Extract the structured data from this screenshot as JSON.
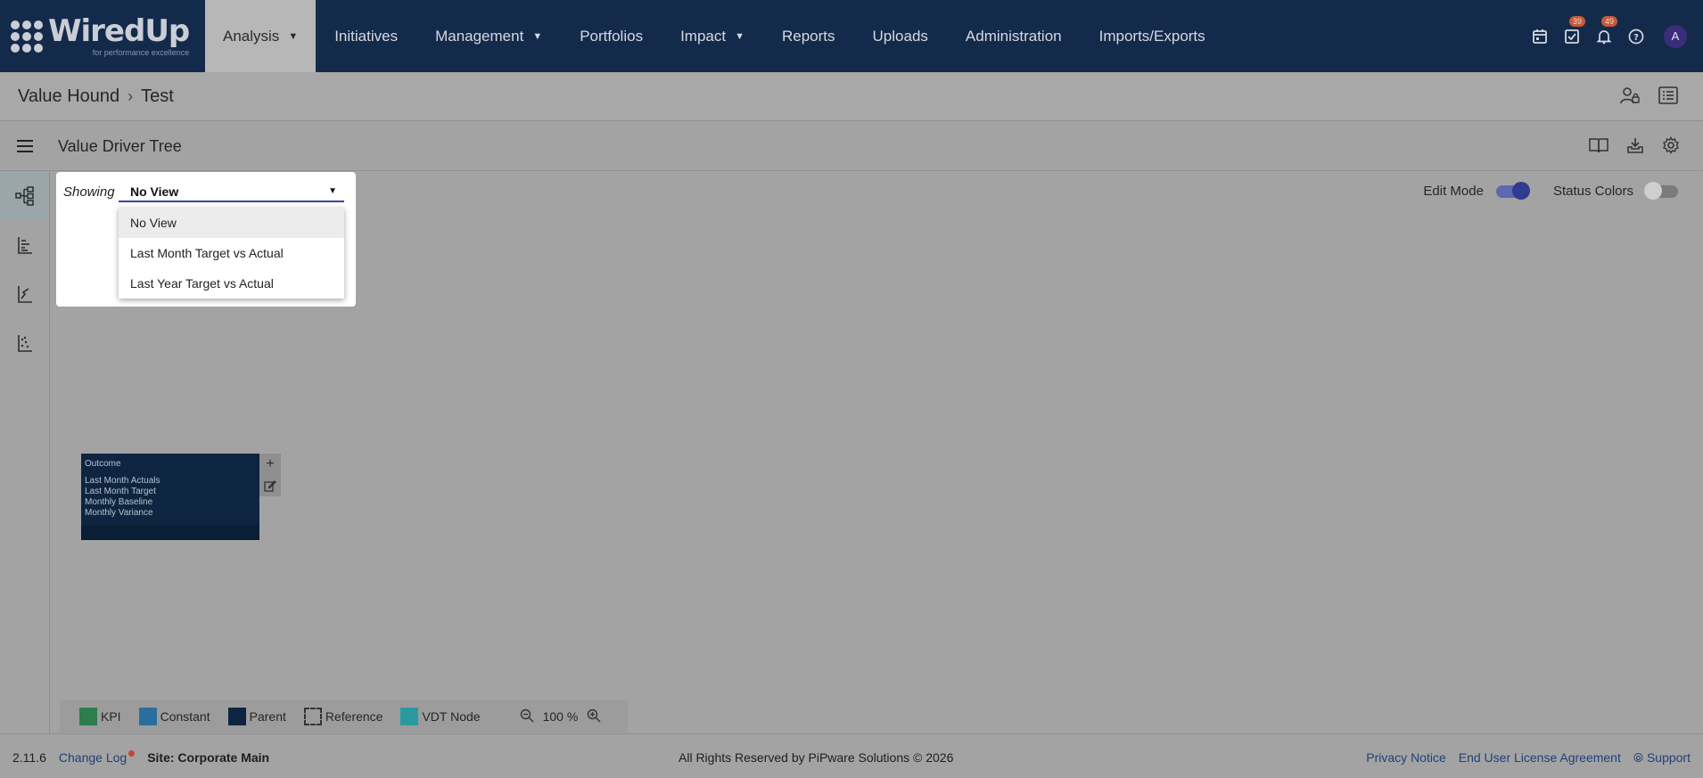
{
  "brand": {
    "name": "WiredUp",
    "tagline": "for performance excellence"
  },
  "nav": {
    "items": [
      {
        "label": "Analysis",
        "active": true,
        "caret": true
      },
      {
        "label": "Initiatives",
        "active": false,
        "caret": false
      },
      {
        "label": "Management",
        "active": false,
        "caret": true
      },
      {
        "label": "Portfolios",
        "active": false,
        "caret": false
      },
      {
        "label": "Impact",
        "active": false,
        "caret": true
      },
      {
        "label": "Reports",
        "active": false,
        "caret": false
      },
      {
        "label": "Uploads",
        "active": false,
        "caret": false
      },
      {
        "label": "Administration",
        "active": false,
        "caret": false
      },
      {
        "label": "Imports/Exports",
        "active": false,
        "caret": false
      }
    ],
    "icons": {
      "calendar": "calendar-icon",
      "tasks": "task-check-icon",
      "tasks_badge": "39",
      "bell": "bell-icon",
      "bell_badge": "49",
      "help": "help-icon",
      "avatar_initial": "A"
    }
  },
  "breadcrumb": {
    "parent": "Value Hound",
    "current": "Test"
  },
  "subheader": {
    "title": "Value Driver Tree"
  },
  "view": {
    "showing_label": "Showing",
    "selected": "No View",
    "options": [
      "No View",
      "Last Month Target vs Actual",
      "Last Year Target vs Actual"
    ]
  },
  "toggles": {
    "edit_mode": {
      "label": "Edit Mode",
      "on": true
    },
    "status_colors": {
      "label": "Status Colors",
      "on": false
    }
  },
  "node": {
    "title": "Outcome",
    "lines": [
      "Last Month Actuals",
      "Last Month Target",
      "Monthly Baseline",
      "Monthly Variance"
    ]
  },
  "legend": {
    "items": [
      {
        "label": "KPI",
        "color": "#2d7d4f"
      },
      {
        "label": "Constant",
        "color": "#2a6e9e"
      },
      {
        "label": "Parent",
        "color": "#0e2541"
      },
      {
        "label": "Reference",
        "color": "dashed"
      },
      {
        "label": "VDT Node",
        "color": "#2a9aa0"
      }
    ],
    "zoom": "100 %"
  },
  "footer": {
    "version": "2.11.6",
    "changelog": "Change Log",
    "site": "Site: Corporate Main",
    "copyright": "All Rights Reserved by PiPware Solutions © 2026",
    "privacy": "Privacy Notice",
    "eula": "End User License Agreement",
    "support": "Support"
  },
  "colors": {
    "navbar": "#142a4b",
    "accent": "#3a44a0",
    "badge": "#c45a3a"
  }
}
